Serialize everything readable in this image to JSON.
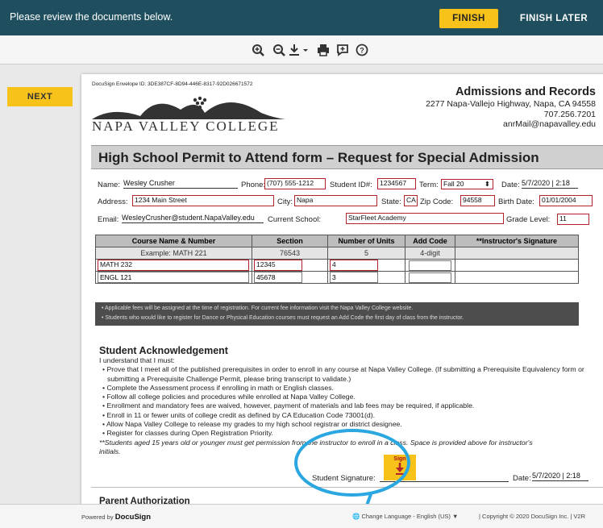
{
  "topbar": {
    "message": "Please review the documents below.",
    "finish": "FINISH",
    "finish_later": "FINISH LATER"
  },
  "toolbar": {
    "icons": [
      "zoom-in-icon",
      "zoom-out-icon",
      "download-icon",
      "print-icon",
      "comment-icon",
      "help-icon"
    ]
  },
  "sidebar": {
    "next": "NEXT"
  },
  "doc": {
    "envelope": "DocuSign Envelope ID: 3DE387CF-8D94-446E-8317-92D026671572",
    "college": "NAPA VALLEY COLLEGE",
    "office": "Admissions and Records",
    "addr1": "2277 Napa-Vallejo Highway, Napa, CA 94558",
    "phone": "707.256.7201",
    "email": "anrMail@napavalley.edu",
    "title": "High School Permit to Attend form – Request for Special Admission",
    "labels": {
      "name": "Name:",
      "phone": "Phone:",
      "student_id": "Student ID#:",
      "term": "Term:",
      "date": "Date:",
      "address": "Address:",
      "city": "City:",
      "state": "State:",
      "zip": "Zip Code:",
      "birth": "Birth Date:",
      "email": "Email:",
      "school": "Current School:",
      "grade": "Grade Level:"
    },
    "values": {
      "name": "Wesley Crusher",
      "phone": "(707) 555-1212",
      "student_id": "1234567",
      "term": "Fall 20",
      "date": "5/7/2020 | 2:18",
      "address": "1234 Main Street",
      "city": "Napa",
      "state": "CA",
      "zip": "94558",
      "birth": "01/01/2004",
      "email": "WesleyCrusher@student.NapaValley.edu",
      "school": "StarFleet Academy",
      "grade": "11"
    },
    "table": {
      "headers": [
        "Course Name & Number",
        "Section",
        "Number of Units",
        "Add Code",
        "**Instructor's Signature"
      ],
      "example": [
        "Example:    MATH 221",
        "76543",
        "5",
        "4-digit",
        ""
      ],
      "rows": [
        [
          "MATH 232",
          "12345",
          "4",
          "",
          ""
        ],
        [
          "ENGL 121",
          "45678",
          "3",
          "",
          ""
        ]
      ]
    },
    "notice": [
      "• Applicable fees will be assigned at the time of registration. For current fee information visit the Napa Valley College website.",
      "• Students who would like to register for Dance or Physical Education courses must request an Add Code the first day of class from the instructor."
    ],
    "ack_title": "Student Acknowledgement",
    "ack_intro": "I understand that I must:",
    "ack_items": [
      "• Prove that I meet all of the published prerequisites in order to enroll in any course at Napa Valley College. (If submitting a Prerequisite Equivalency form or submitting a Prerequisite Challenge Permit, please bring transcript to validate.)",
      "• Complete the Assessment process if enrolling in math or English classes.",
      "• Follow all college policies and procedures while enrolled at Napa Valley College.",
      "• Enrollment and mandatory fees are waived, however, payment of materials and lab fees may be required, if applicable.",
      "• Enroll in 11 or fewer units of college credit as defined by CA Education Code 73001(d).",
      "• Allow Napa Valley College to release my grades to my high school registrar or district designee.",
      "• Register for classes during Open Registration Priority."
    ],
    "ack_note": "**Students aged 15 years old or younger must get permission from the instructor to enroll in a class. Space is provided above for instructor's initials.",
    "sig_label": "Student Signature:",
    "sign_tag": "Sign",
    "sig_date_label": "Date:",
    "sig_date": "5/7/2020 | 2:18",
    "parent": "Parent Authorization"
  },
  "footer": {
    "powered": "Powered by",
    "brand": "DocuSign",
    "language": "Change Language - English (US)",
    "copyright": "|   Copyright © 2020 DocuSign Inc.  |  V2R"
  },
  "colors": {
    "topbar": "#1f4f5e",
    "accent": "#f7c21a",
    "field_border": "#b3242a",
    "highlight": "#2aa7e0"
  }
}
